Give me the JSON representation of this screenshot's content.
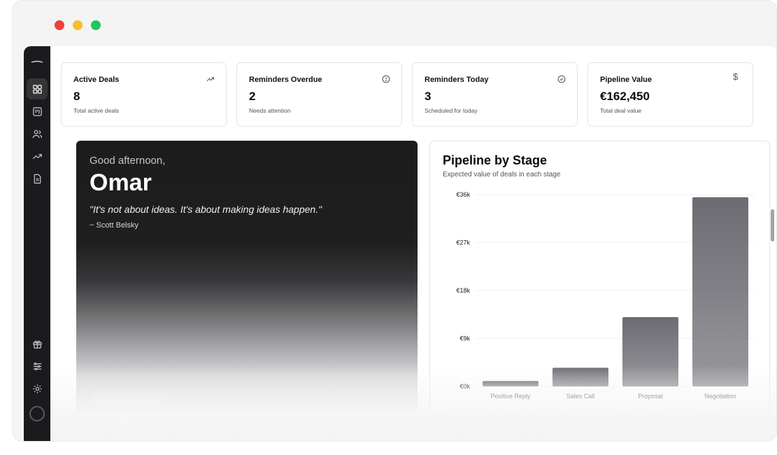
{
  "stats": [
    {
      "title": "Active Deals",
      "value": "8",
      "sub": "Total active deals",
      "icon": "trending-up-icon"
    },
    {
      "title": "Reminders Overdue",
      "value": "2",
      "sub": "Needs attention",
      "icon": "alert-circle-icon"
    },
    {
      "title": "Reminders Today",
      "value": "3",
      "sub": "Scheduled for today",
      "icon": "check-circle-icon"
    },
    {
      "title": "Pipeline Value",
      "value": "€162,450",
      "sub": "Total deal value",
      "icon": "dollar-icon",
      "symbol": "$"
    }
  ],
  "hero": {
    "greeting": "Good afternoon,",
    "name": "Omar",
    "quote": "\"It's not about ideas. It's about making ideas happen.\"",
    "author": "~ Scott Belsky",
    "add_button": "Add a new deal",
    "add_symbol": "+"
  },
  "chart": {
    "title": "Pipeline by Stage",
    "subtitle": "Expected value of deals in each stage"
  },
  "chart_data": {
    "type": "bar",
    "categories": [
      "Positive Reply",
      "Sales Call",
      "Proposal",
      "Negotiation"
    ],
    "values": [
      1000,
      3500,
      13000,
      35500
    ],
    "yticks": [
      "€0k",
      "€9k",
      "€18k",
      "€27k",
      "€36k"
    ],
    "ylim": [
      0,
      36000
    ],
    "grid": true,
    "bar_color": "#6b6b72"
  },
  "sidebar": {
    "top_icons": [
      "dashboard-icon",
      "kanban-icon",
      "users-icon",
      "trending-up-icon",
      "document-icon"
    ],
    "bottom_icons": [
      "gift-icon",
      "sliders-icon",
      "settings-icon",
      "avatar"
    ]
  },
  "colors": {
    "accent": "#1b1b1d",
    "close": "#ef4136",
    "minimize": "#f7c02b",
    "maximize": "#22c55e"
  }
}
